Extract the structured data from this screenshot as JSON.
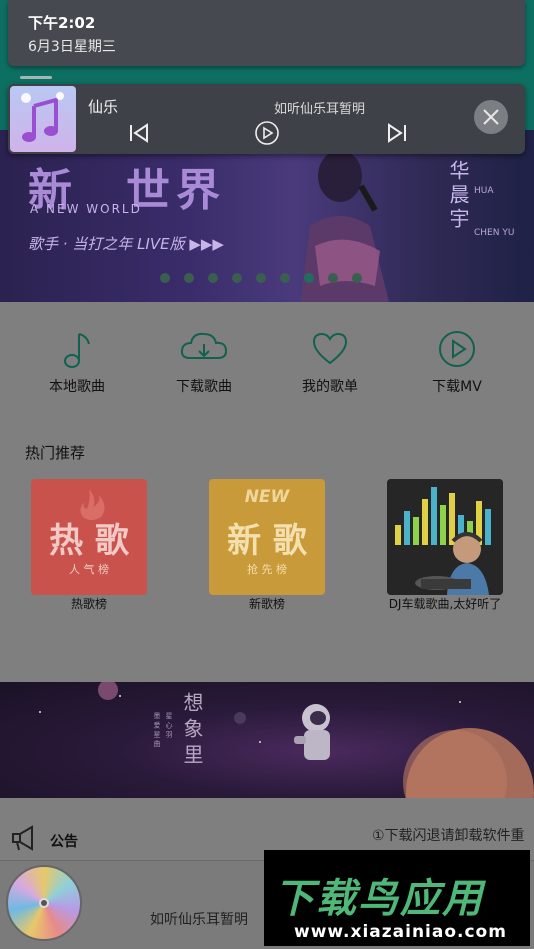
{
  "notification": {
    "time": "下午2:02",
    "date": "6月3日星期三"
  },
  "player": {
    "app_name": "仙乐",
    "song": "如听仙乐耳暂明",
    "controls": [
      "prev-icon",
      "play-icon",
      "next-icon",
      "close-icon"
    ]
  },
  "banner": {
    "title_part1": "新",
    "title_part2": "世界",
    "subtitle_en": "A NEW WORLD",
    "subtitle_cn": "歌手 · 当打之年 LIVE版 ▶▶▶",
    "singer_cn": "华晨宇",
    "singer_en1": "HUA",
    "singer_en2": "CHEN YU",
    "dots": 9,
    "active_dot": 6
  },
  "quick_nav": [
    {
      "label": "本地歌曲",
      "icon": "music-note-icon"
    },
    {
      "label": "下载歌曲",
      "icon": "cloud-download-icon"
    },
    {
      "label": "我的歌单",
      "icon": "heart-icon"
    },
    {
      "label": "下载MV",
      "icon": "play-circle-icon"
    }
  ],
  "hot_section": {
    "title": "热门推荐",
    "cards": [
      {
        "big": "热 歌",
        "small": "人 气 榜",
        "label": "热歌榜",
        "color": "#c9524d"
      },
      {
        "new": "NEW",
        "big": "新 歌",
        "small": "抢 先 榜",
        "label": "新歌榜",
        "color": "#c89a3a"
      },
      {
        "label": "DJ车载歌曲,太好听了",
        "color": "#2b2b2b"
      }
    ]
  },
  "space_banner": {
    "title": "想象里",
    "small1": "星 心 羽",
    "small2": "墨 爱 星 曲"
  },
  "notice": {
    "label": "公告",
    "text": "①下载闪退请卸载软件重"
  },
  "bottom": {
    "song": "如听仙乐耳暂明"
  },
  "watermark": {
    "brand": "下载鸟应用",
    "url": "www.xiazainiao.com"
  }
}
